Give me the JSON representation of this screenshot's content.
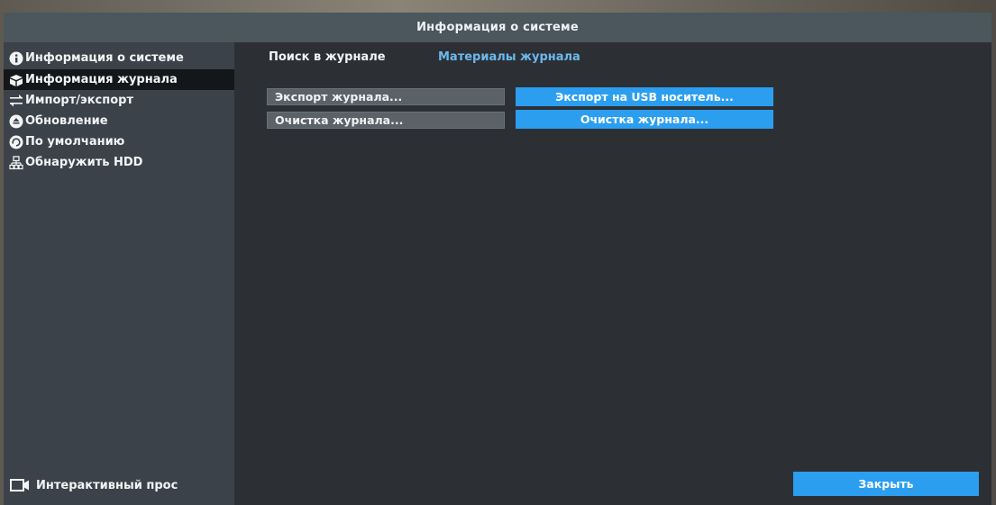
{
  "window": {
    "title": "Информация о системе"
  },
  "sidebar": {
    "items": [
      {
        "label": "Информация о системе",
        "icon": "info-circle-icon"
      },
      {
        "label": "Информация журнала",
        "icon": "box-icon",
        "active": true
      },
      {
        "label": "Импорт/экспорт",
        "icon": "import-export-arrows-icon"
      },
      {
        "label": "Обновление",
        "icon": "upload-circle-icon"
      },
      {
        "label": "По умолчанию",
        "icon": "reset-circle-icon"
      },
      {
        "label": "Обнаружить HDD",
        "icon": "network-tree-icon"
      }
    ],
    "live_view": {
      "label": "Интерактивный прос",
      "icon": "video-camera-icon"
    }
  },
  "tabs": {
    "search": "Поиск в журнале",
    "materials": "Материалы журнала"
  },
  "actions": {
    "export_log": "Экспорт журнала...",
    "clear_log": "Очистка журнала...",
    "export_usb": "Экспорт на USB носитель...",
    "clear_log_confirm": "Очистка журнала..."
  },
  "footer": {
    "close": "Закрыть"
  },
  "colors": {
    "accent": "#2b9ef0",
    "tab_active_text": "#6db8ee",
    "titlebar": "#4b565d",
    "sidebar": "#3b4249",
    "content": "#2c3035"
  }
}
